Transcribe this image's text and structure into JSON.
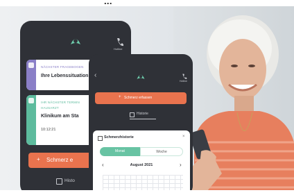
{
  "header_partial": "...",
  "phone_back": {
    "call_label": "Hotline",
    "card1": {
      "label": "NÄCHSTER FRAGEBOGEN",
      "title": "Ihre Lebenssituation"
    },
    "card2": {
      "label": "IHR NÄCHSTER TERMIN",
      "subtag": "HAUSARZT",
      "title": "Klinikum am Sta",
      "time": "10:12:21"
    },
    "add_button": "Schmerz e",
    "history": "Histo"
  },
  "phone_front": {
    "call_label": "Hotline",
    "add_button": "Schmerz erfassen",
    "history_tab": "Historie",
    "panel": {
      "title": "Schmerzhistorie",
      "seg_month": "Monat",
      "seg_week": "Woche",
      "month_label": "August 2021"
    }
  },
  "colors": {
    "accent": "#e9734e",
    "teal": "#68c3a3",
    "purple": "#8a7fc7",
    "dark": "#2f3137"
  }
}
